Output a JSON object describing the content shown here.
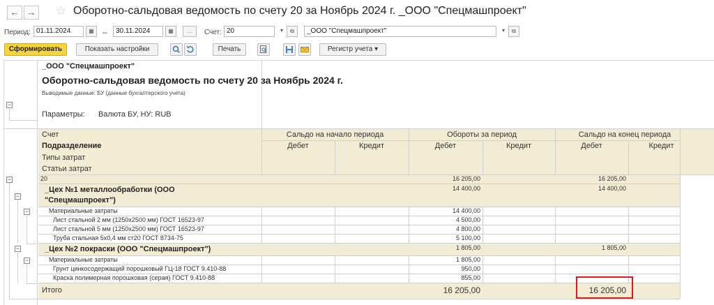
{
  "window": {
    "title": "Оборотно-сальдовая ведомость по счету 20 за Ноябрь 2024 г. _ООО \"Спецмашпроект\"",
    "back_glyph": "←",
    "forward_glyph": "→",
    "star_glyph": "☆"
  },
  "params": {
    "period_label": "Период:",
    "date_from": "01.11.2024",
    "dash": "–",
    "date_to": "30.11.2024",
    "ellipsis": "...",
    "account_label": "Счет:",
    "account_value": "20",
    "org_value": "_ООО \"Спецмашпроект\""
  },
  "toolbar": {
    "generate": "Сформировать",
    "show_settings": "Показать настройки",
    "print": "Печать",
    "register": "Регистр учета"
  },
  "report": {
    "org": "_ООО \"Спецмашпроект\"",
    "title": "Оборотно-сальдовая ведомость по счету 20 за Ноябрь 2024 г.",
    "output_data": "Выводимые данные: БУ (данные бухгалтерского учета)",
    "params_label": "Параметры:",
    "params_value": "Валюта БУ, НУ: RUB",
    "columns": {
      "account": "Счет",
      "subdivision": "Подразделение",
      "cost_types": "Типы затрат",
      "cost_items": "Статьи затрат",
      "opening": "Сальдо на начало периода",
      "turnover": "Обороты за период",
      "closing": "Сальдо на конец периода",
      "debit": "Дебет",
      "credit": "Кредит"
    },
    "rows": [
      {
        "name": "20",
        "turnover_debit": "16 205,00",
        "closing_debit": "16 205,00"
      },
      {
        "name": "_Цех №1 металлообработки (ООО",
        "name2": "\"Спецмашпроект\")",
        "turnover_debit": "14 400,00",
        "closing_debit": "14 400,00"
      },
      {
        "name": "Материальные затраты",
        "turnover_debit": "14 400,00"
      },
      {
        "name": "Лист стальной 2 мм (1250x2500 мм) ГОСТ 16523-97",
        "turnover_debit": "4 500,00"
      },
      {
        "name": "Лист стальной 5 мм (1250x2500 мм) ГОСТ 16523-97",
        "turnover_debit": "4 800,00"
      },
      {
        "name": "Труба стальная 5x0,4 мм ст20 ГОСТ 8734-75",
        "turnover_debit": "5 100,00"
      },
      {
        "name": "_Цех №2 покраски (ООО \"Спецмашпроект\")",
        "turnover_debit": "1 805,00",
        "closing_debit": "1 805,00"
      },
      {
        "name": "Материальные затраты",
        "turnover_debit": "1 805,00"
      },
      {
        "name": "Грунт цинкосодержащий порошковый ГЦ-18 ГОСТ 9.410-88",
        "turnover_debit": "950,00"
      },
      {
        "name": "Краска полимерная порошковая (серая) ГОСТ 9.410-88",
        "turnover_debit": "855,00"
      }
    ],
    "total": {
      "name": "Итого",
      "turnover_debit": "16 205,00",
      "closing_debit": "16 205,00"
    }
  }
}
